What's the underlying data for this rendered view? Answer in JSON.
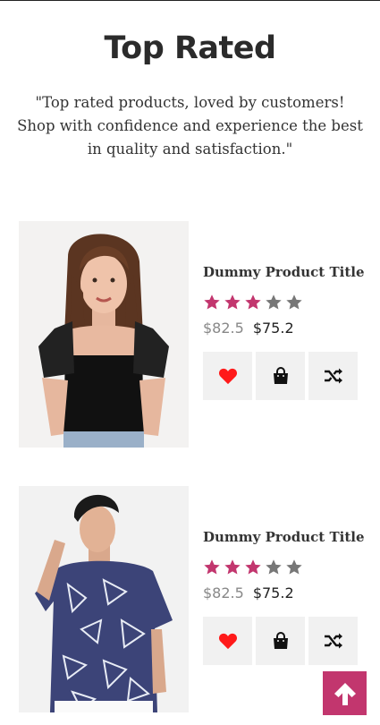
{
  "section": {
    "title": "Top Rated",
    "description": "\"Top rated products, loved by customers! Shop with confidence and experience the best in quality and satisfaction.\""
  },
  "colors": {
    "star_filled": "#c2366e",
    "star_empty": "#777777",
    "wishlist_heart": "#ff1a1a",
    "scroll_top_bg": "#c2366e"
  },
  "products": [
    {
      "title": "Dummy Product Title",
      "rating": 3,
      "rating_max": 5,
      "old_price": "$82.5",
      "new_price": "$75.2",
      "image_icon": "model-black-crop-top-photo"
    },
    {
      "title": "Dummy Product Title",
      "rating": 3,
      "rating_max": 5,
      "old_price": "$82.5",
      "new_price": "$75.2",
      "image_icon": "model-printed-shirt-photo"
    }
  ],
  "actions": {
    "wishlist_icon": "heart-icon",
    "cart_icon": "shopping-bag-icon",
    "compare_icon": "shuffle-icon"
  },
  "scroll_top_icon": "arrow-up-icon"
}
